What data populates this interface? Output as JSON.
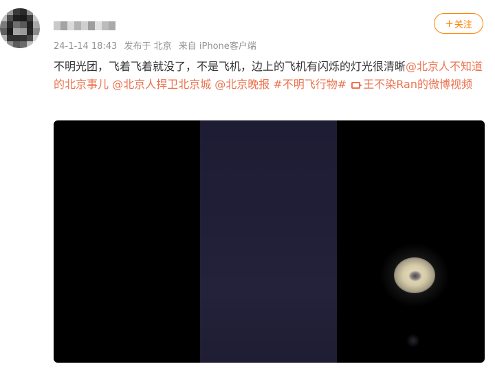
{
  "post": {
    "author": {
      "avatar_note": "pixelated-avatar",
      "username_blurred": true
    },
    "meta": {
      "time": "24-1-14 18:43",
      "published_from": "发布于 北京",
      "source": "来自 iPhone客户端"
    },
    "follow_button": {
      "label": "关注",
      "plus": "+"
    },
    "text": {
      "body": "不明光团，飞着飞着就没了，不是飞机，边上的飞机有闪烁的灯光很清晰",
      "mention1": "@北京人不知道的北京事儿",
      "mention2": "@北京人捍卫北京城",
      "mention3": "@北京晚报",
      "topic": "#不明飞行物#",
      "video_link": "王不染Ran的微博视频"
    },
    "video": {
      "icon": "video-camera-icon"
    }
  },
  "colors": {
    "accent": "#ff8200",
    "link": "#eb7350",
    "meta_text": "#939393",
    "body_text": "#333333"
  }
}
